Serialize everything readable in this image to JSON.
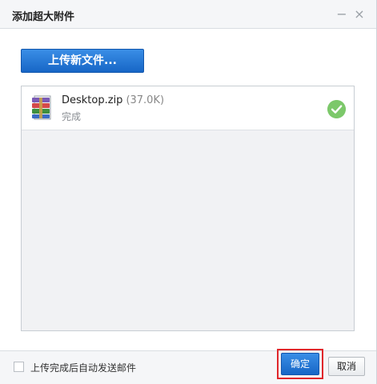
{
  "dialog": {
    "title": "添加超大附件",
    "minimize_symbol": "−",
    "close_symbol": "×"
  },
  "toolbar": {
    "upload_label": "上传新文件..."
  },
  "files": [
    {
      "name": "Desktop.zip",
      "size": "(37.0K)",
      "status": "完成",
      "icon": "winrar-archive-icon",
      "status_icon": "check-circle-icon",
      "status_color": "#7cc86a"
    }
  ],
  "footer": {
    "auto_send_label": "上传完成后自动发送邮件",
    "auto_send_checked": false,
    "ok_label": "确定",
    "cancel_label": "取消"
  },
  "colors": {
    "primary_button": "#1f74d6",
    "highlight_border": "#e0272b",
    "success": "#7cc86a"
  }
}
